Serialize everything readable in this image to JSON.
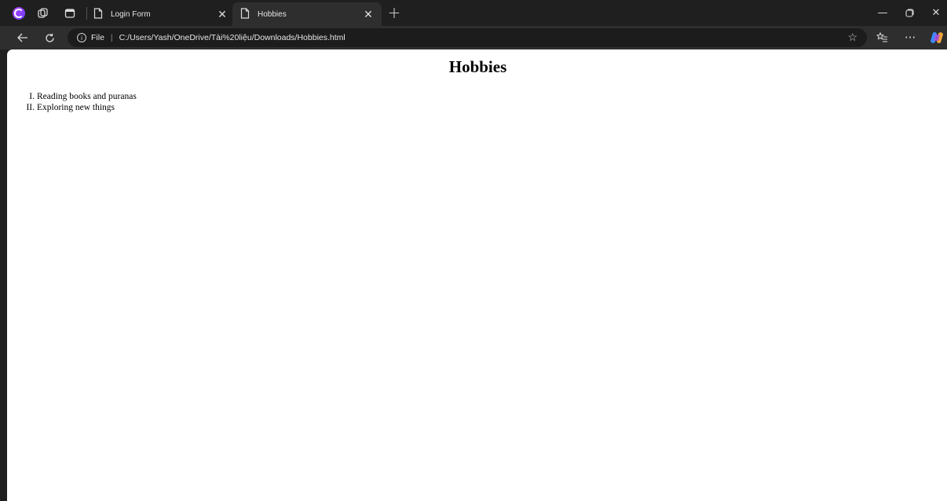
{
  "browser": {
    "tabs": [
      {
        "label": "Login Form",
        "active": false
      },
      {
        "label": "Hobbies",
        "active": true
      }
    ],
    "address_bar": {
      "site_label": "File",
      "url": "C:/Users/Yash/OneDrive/Tài%20liệu/Downloads/Hobbies.html"
    },
    "icons": {
      "profile": "profile-icon",
      "workspaces": "workspaces-icon",
      "tab_actions": "tab-actions-icon",
      "back": "back-arrow-icon",
      "reload": "reload-icon",
      "favorite": "star-icon",
      "favorites": "favorites-icon",
      "more": "more-icon",
      "copilot": "copilot-icon"
    }
  },
  "page": {
    "title": "Hobbies",
    "hobbies": [
      {
        "marker": "I.",
        "text": "Reading books and puranas"
      },
      {
        "marker": "II.",
        "text": "Exploring new things"
      }
    ]
  },
  "colors": {
    "chrome_dark": "#1f1f1f",
    "chrome_toolbar": "#2e2e2e",
    "page_background": "#ffffff"
  }
}
